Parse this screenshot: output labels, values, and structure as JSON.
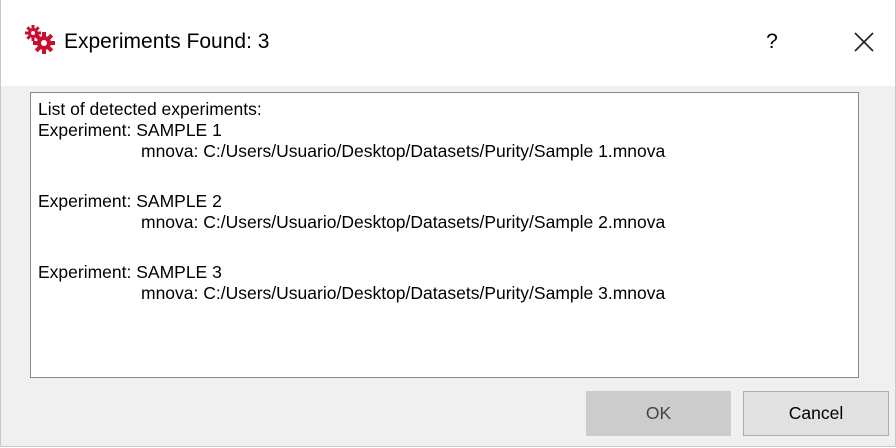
{
  "window": {
    "title": "Experiments Found: 3",
    "help_label": "?",
    "icon": "gears-icon",
    "icon_color": "#c8102e"
  },
  "content": {
    "header": "List of detected experiments:",
    "experiments": [
      {
        "label": "Experiment: SAMPLE 1",
        "path": "mnova: C:/Users/Usuario/Desktop/Datasets/Purity/Sample 1.mnova"
      },
      {
        "label": "Experiment: SAMPLE 2",
        "path": "mnova: C:/Users/Usuario/Desktop/Datasets/Purity/Sample 2.mnova"
      },
      {
        "label": "Experiment: SAMPLE 3",
        "path": "mnova: C:/Users/Usuario/Desktop/Datasets/Purity/Sample 3.mnova"
      }
    ]
  },
  "buttons": {
    "ok_label": "OK",
    "cancel_label": "Cancel"
  }
}
